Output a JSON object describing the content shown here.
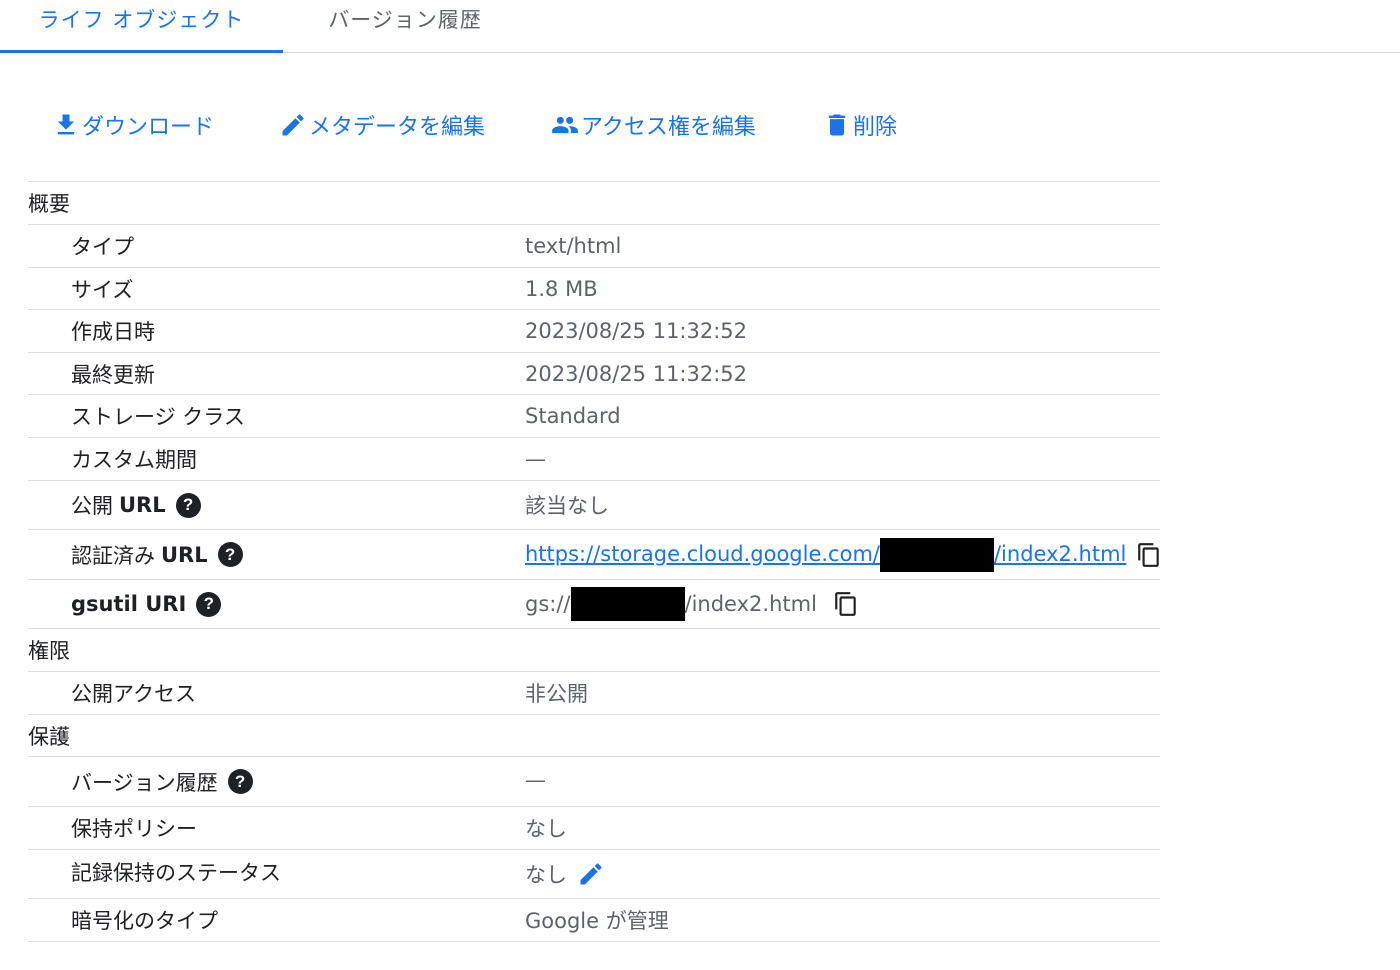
{
  "tabs": [
    {
      "label": "ライフ オブジェクト",
      "active": true
    },
    {
      "label": "バージョン履歴",
      "active": false
    }
  ],
  "toolbar": {
    "download": {
      "label": "ダウンロード",
      "icon": "download-icon"
    },
    "edit_metadata": {
      "label": "メタデータを編集",
      "icon": "pencil-icon"
    },
    "edit_access": {
      "label": "アクセス権を編集",
      "icon": "people-icon"
    },
    "delete": {
      "label": "削除",
      "icon": "trash-icon"
    }
  },
  "sections": {
    "overview": {
      "title": "概要",
      "type": {
        "label": "タイプ",
        "value": "text/html"
      },
      "size": {
        "label": "サイズ",
        "value": "1.8 MB"
      },
      "created": {
        "label": "作成日時",
        "value": "2023/08/25 11:32:52"
      },
      "updated": {
        "label": "最終更新",
        "value": "2023/08/25 11:32:52"
      },
      "storage_class": {
        "label": "ストレージ クラス",
        "value": "Standard"
      },
      "custom_time": {
        "label": "カスタム期間",
        "value": "—"
      },
      "public_url": {
        "label_prefix": "公開",
        "label_bold": "URL",
        "value": "該当なし"
      },
      "auth_url": {
        "label_prefix": "認証済み",
        "label_bold": "URL",
        "value_prefix": "https://storage.cloud.google.com/",
        "value_suffix": "/index2.html"
      },
      "gsutil_uri": {
        "label": "gsutil URI",
        "value_prefix": "gs://",
        "value_suffix": "/index2.html"
      }
    },
    "permissions": {
      "title": "権限",
      "public_access": {
        "label": "公開アクセス",
        "value": "非公開"
      }
    },
    "protection": {
      "title": "保護",
      "version_history": {
        "label": "バージョン履歴",
        "value": "—"
      },
      "retention_policy": {
        "label": "保持ポリシー",
        "value": "なし"
      },
      "retention_status": {
        "label": "記録保持のステータス",
        "value": "なし"
      },
      "encryption": {
        "label": "暗号化のタイプ",
        "value": "Google が管理"
      }
    }
  },
  "help_glyph": "?",
  "colors": {
    "accent": "#1a73e8",
    "text": "#202124",
    "secondary": "#5f6368",
    "divider": "#dadce0"
  }
}
